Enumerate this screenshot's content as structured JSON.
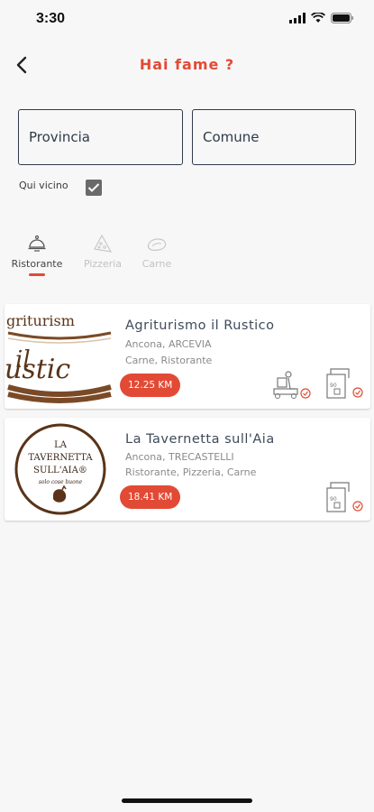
{
  "status": {
    "time": "3:30"
  },
  "header": {
    "title": "Hai fame ?"
  },
  "filters": {
    "provincia_placeholder": "Provincia",
    "comune_placeholder": "Comune",
    "near_label": "Qui vicino",
    "near_checked": true
  },
  "categories": [
    {
      "label": "Ristorante",
      "icon": "cloche-icon",
      "active": true
    },
    {
      "label": "Pizzeria",
      "icon": "pizza-icon",
      "active": false
    },
    {
      "label": "Carne",
      "icon": "meat-icon",
      "active": false
    }
  ],
  "restaurants": [
    {
      "name": "Agriturismo il Rustico",
      "location": "Ancona, ARCEVIA",
      "categories": "Carne, Ristorante",
      "distance": "12.25 KM",
      "logo_text": [
        "griturism",
        "il",
        "ustic"
      ],
      "services": [
        "delivery-icon",
        "takeaway-icon"
      ]
    },
    {
      "name": "La Tavernetta sull'Aia",
      "location": "Ancona, TRECASTELLI",
      "categories": "Ristorante, Pizzeria, Carne",
      "distance": "18.41 KM",
      "logo_text": [
        "LA",
        "TAVERNETTA",
        "SULL'AIA®",
        "solo cose buone"
      ],
      "services": [
        "takeaway-icon"
      ]
    }
  ],
  "colors": {
    "accent": "#e24a35",
    "text": "#2f3a4a"
  }
}
